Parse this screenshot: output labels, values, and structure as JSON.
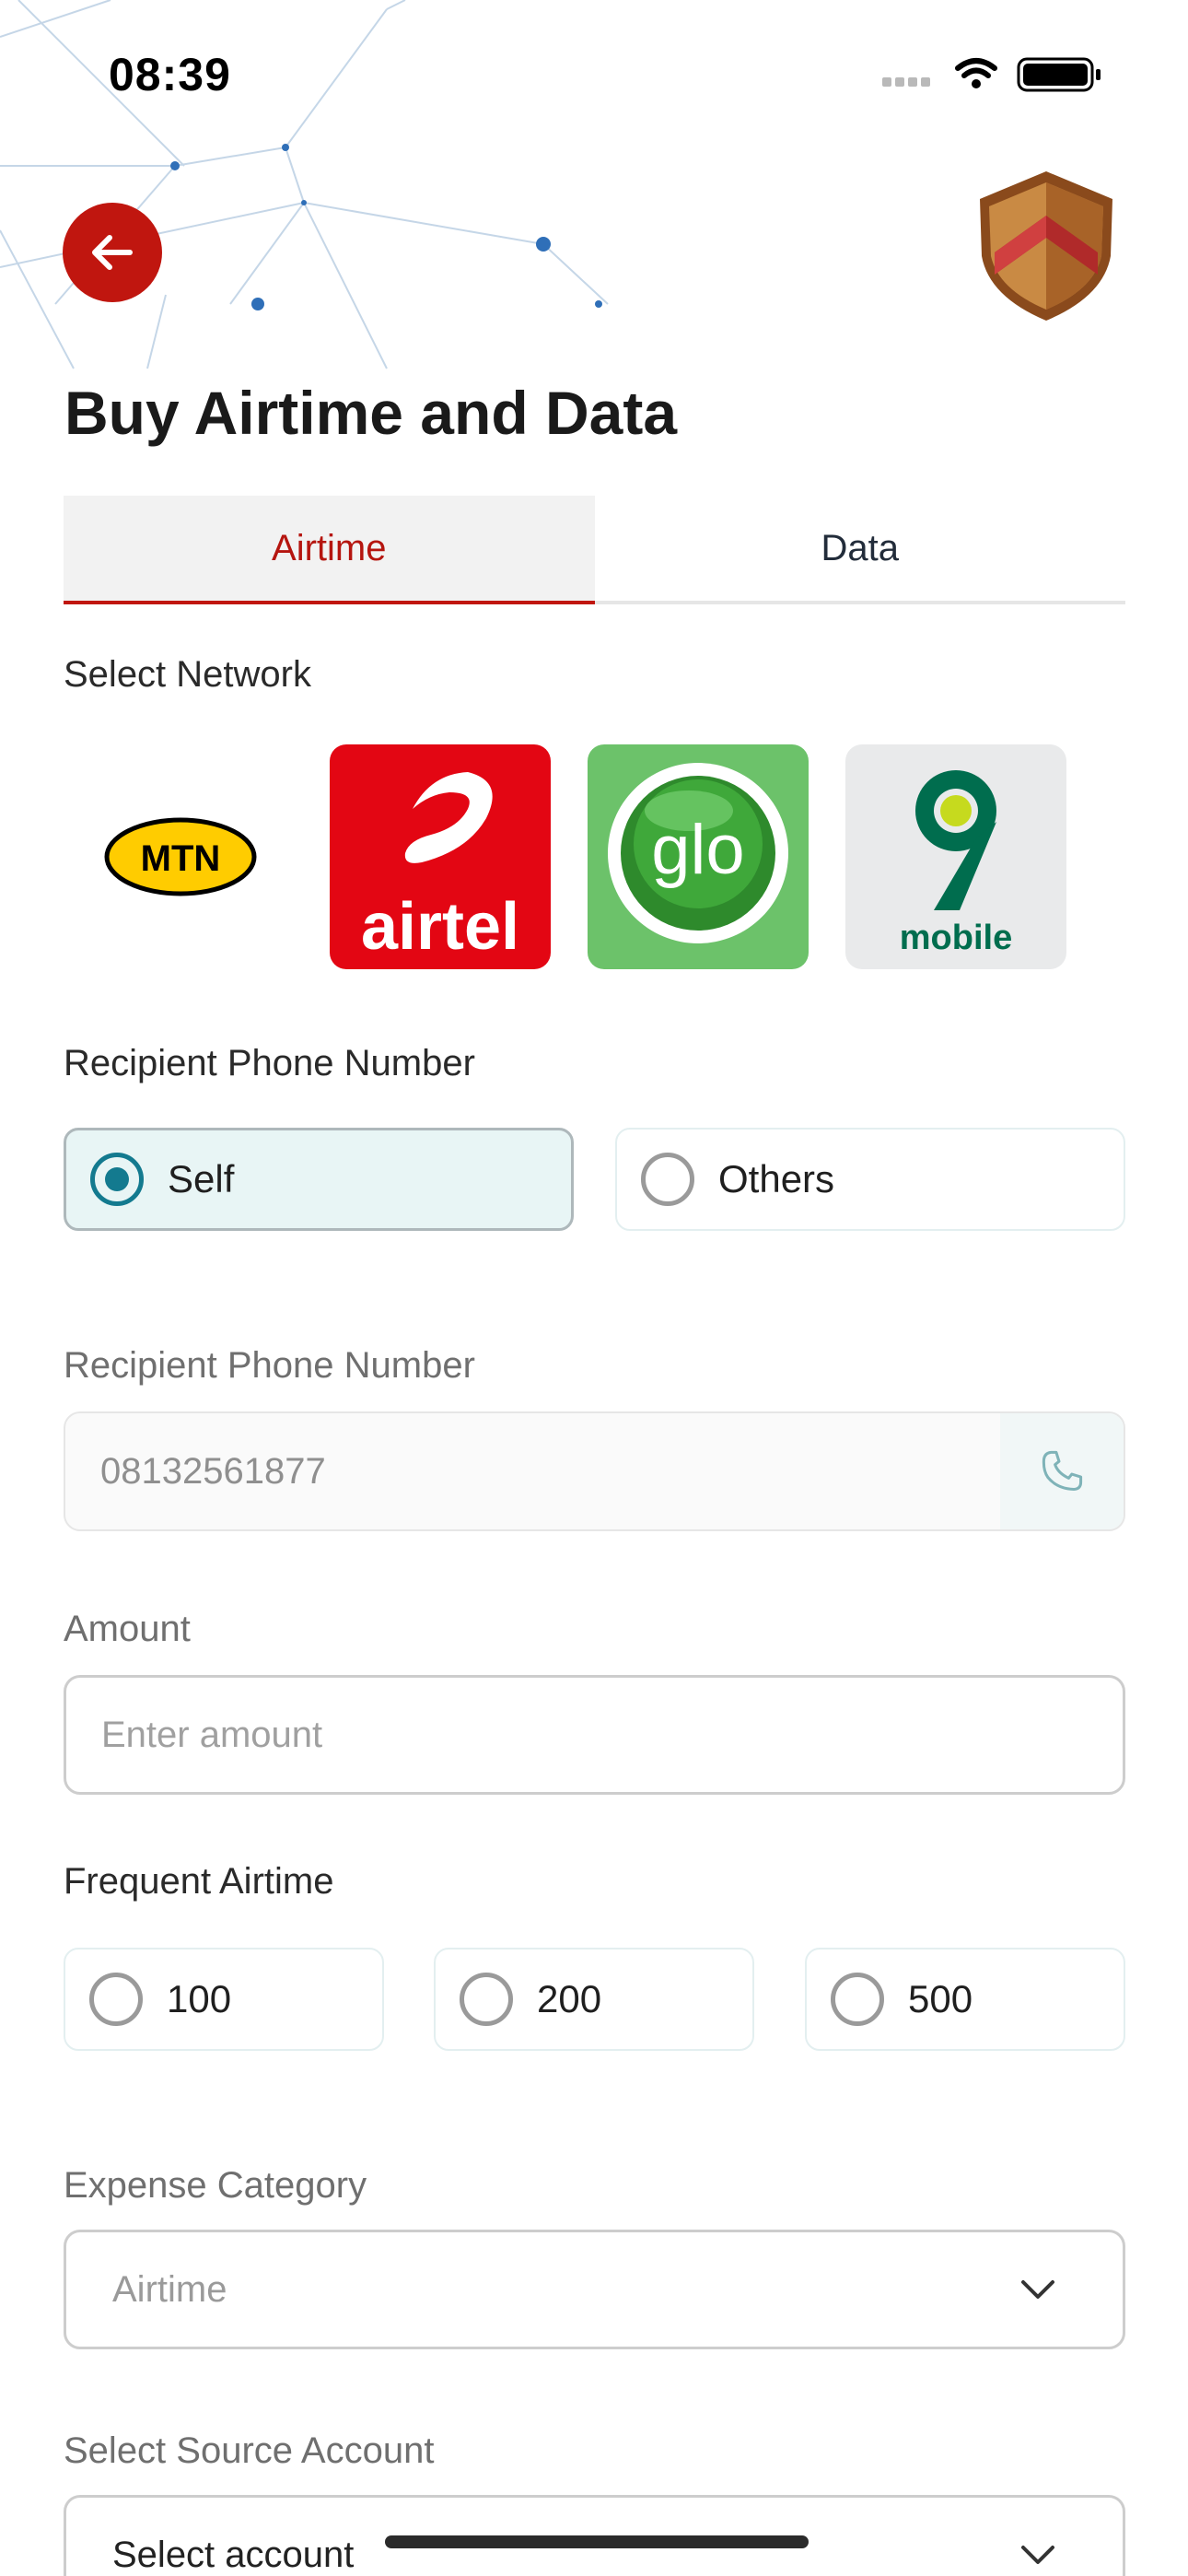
{
  "status_bar": {
    "time": "08:39",
    "icons": [
      "signal-icon",
      "wifi-icon",
      "battery-icon"
    ]
  },
  "header": {
    "back_icon": "arrow-left-icon",
    "badge_icon": "shield-chevron-icon",
    "title": "Buy Airtime and Data"
  },
  "tabs": [
    {
      "label": "Airtime",
      "active": true
    },
    {
      "label": "Data",
      "active": false
    }
  ],
  "network": {
    "label": "Select Network",
    "options": [
      {
        "name": "MTN",
        "logo_text": "MTN",
        "selected": false
      },
      {
        "name": "airtel",
        "logo_text": "airtel",
        "selected": false
      },
      {
        "name": "glo",
        "logo_text": "glo",
        "selected": false
      },
      {
        "name": "9mobile",
        "logo_text": "mobile",
        "selected": false
      }
    ]
  },
  "recipient_type": {
    "label": "Recipient Phone Number",
    "options": [
      {
        "label": "Self",
        "selected": true
      },
      {
        "label": "Others",
        "selected": false
      }
    ]
  },
  "phone_field": {
    "label": "Recipient Phone Number",
    "value": "08132561877",
    "icon": "phone-icon"
  },
  "amount_field": {
    "label": "Amount",
    "placeholder": "Enter amount"
  },
  "frequent_airtime": {
    "label": "Frequent Airtime",
    "options": [
      {
        "label": "100",
        "selected": false
      },
      {
        "label": "200",
        "selected": false
      },
      {
        "label": "500",
        "selected": false
      }
    ]
  },
  "expense_category": {
    "label": "Expense Category",
    "value": "Airtime",
    "icon": "chevron-down-icon"
  },
  "source_account": {
    "label": "Select Source Account",
    "value": "Select account",
    "icon": "chevron-down-icon"
  },
  "colors": {
    "brand_red": "#c0160f",
    "radio_teal": "#137a8f",
    "mtn_yellow": "#ffcc00",
    "airtel_red": "#e30613",
    "glo_green": "#6cc26a",
    "nine_mobile_green": "#006d4e"
  }
}
